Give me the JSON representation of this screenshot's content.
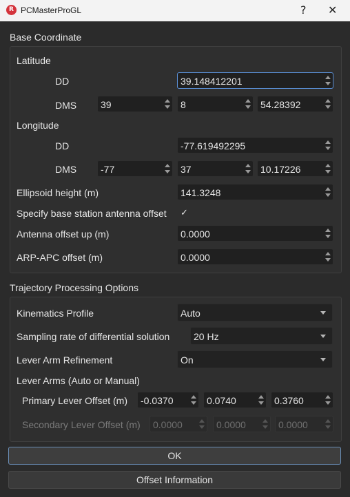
{
  "window": {
    "icon_letter": "R",
    "title": "PCMasterProGL",
    "help": "?",
    "close": "✕"
  },
  "base": {
    "title": "Base Coordinate",
    "latitude_label": "Latitude",
    "lat_dd_label": "DD",
    "lat_dd": "39.148412201",
    "lat_dms_label": "DMS",
    "lat_deg": "39",
    "lat_min": "8",
    "lat_sec": "54.28392",
    "longitude_label": "Longitude",
    "lon_dd_label": "DD",
    "lon_dd": "-77.619492295",
    "lon_dms_label": "DMS",
    "lon_deg": "-77",
    "lon_min": "37",
    "lon_sec": "10.17226",
    "ellipsoid_label": "Ellipsoid height (m)",
    "ellipsoid": "141.3248",
    "antenna_offset_label": "Specify base station antenna offset",
    "antenna_offset_checked": "✓",
    "antenna_up_label": "Antenna offset up (m)",
    "antenna_up": "0.0000",
    "arp_apc_label": "ARP-APC offset (m)",
    "arp_apc": "0.0000"
  },
  "trajectory": {
    "title": "Trajectory Processing Options",
    "kinematics_label": "Kinematics Profile",
    "kinematics": "Auto",
    "sampling_label": "Sampling rate of differential solution",
    "sampling": "20 Hz",
    "lever_refine_label": "Lever Arm Refinement",
    "lever_refine": "On",
    "lever_arms_label": "Lever Arms (Auto or Manual)",
    "primary_label": "Primary Lever Offset (m)",
    "primary": [
      "-0.0370",
      "0.0740",
      "0.3760"
    ],
    "secondary_label": "Secondary Lever Offset (m)",
    "secondary": [
      "0.0000",
      "0.0000",
      "0.0000"
    ]
  },
  "buttons": {
    "ok": "OK",
    "offset_info": "Offset Information"
  }
}
